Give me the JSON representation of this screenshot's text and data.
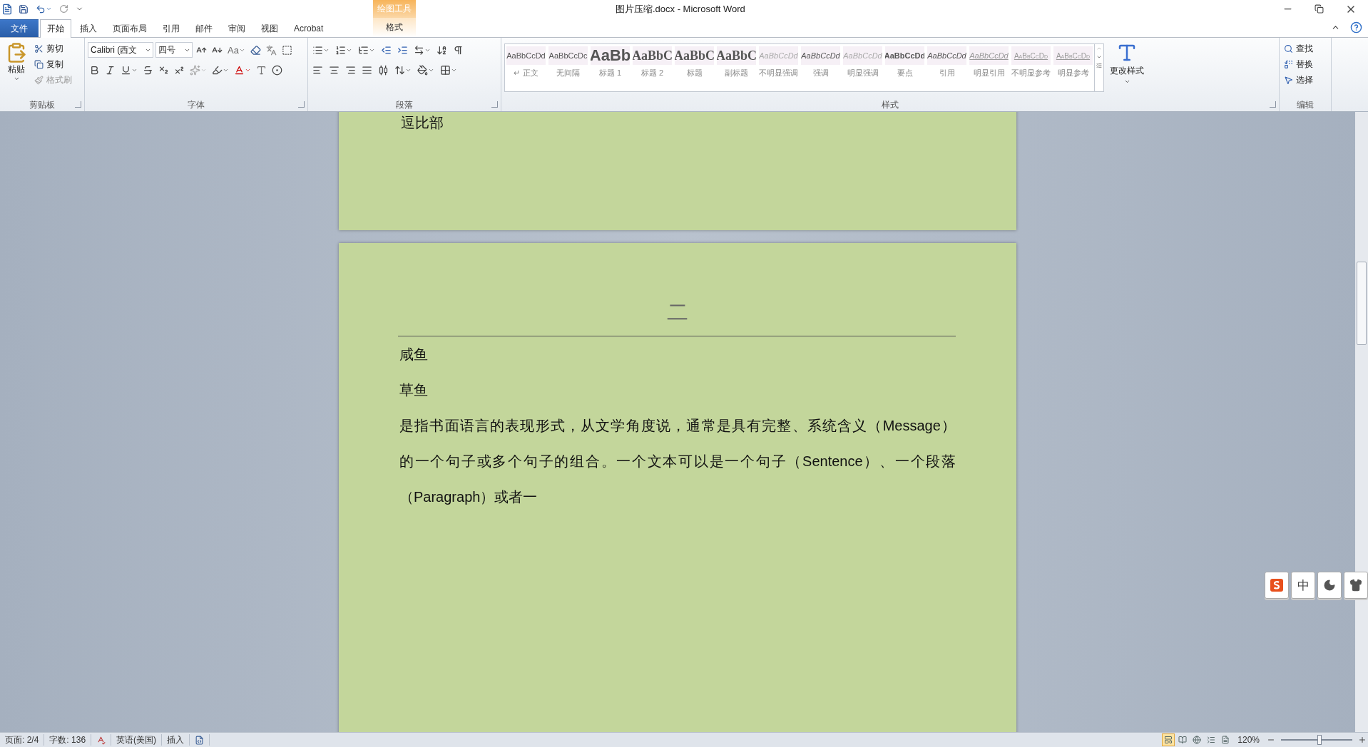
{
  "window": {
    "title": "图片压缩.docx  -  Microsoft Word"
  },
  "tabs": [
    {
      "label": "文件",
      "kind": "file",
      "selected": false
    },
    {
      "label": "开始",
      "kind": "normal",
      "selected": true
    },
    {
      "label": "插入",
      "kind": "normal",
      "selected": false
    },
    {
      "label": "页面布局",
      "kind": "normal",
      "selected": false
    },
    {
      "label": "引用",
      "kind": "normal",
      "selected": false
    },
    {
      "label": "邮件",
      "kind": "normal",
      "selected": false
    },
    {
      "label": "审阅",
      "kind": "normal",
      "selected": false
    },
    {
      "label": "视图",
      "kind": "normal",
      "selected": false
    },
    {
      "label": "Acrobat",
      "kind": "normal",
      "selected": false
    }
  ],
  "contextual_tabs": {
    "group": "绘图工具",
    "tabs": [
      {
        "label": "格式",
        "selected": false
      }
    ]
  },
  "ribbon": {
    "clipboard": {
      "paste": "粘贴",
      "group_label": "剪贴板",
      "buttons": [
        {
          "label": "剪切",
          "kind": "cut",
          "disabled": false
        },
        {
          "label": "复制",
          "kind": "copy",
          "disabled": false
        },
        {
          "label": "格式刷",
          "kind": "brush",
          "disabled": true
        }
      ]
    },
    "font": {
      "font_name": "Calibri (西文",
      "font_size": "四号",
      "change_case": "Aa",
      "group_label": "字体"
    },
    "paragraph": {
      "group_label": "段落"
    },
    "styles": {
      "group_label": "样式",
      "change_styles": "更改样式",
      "items": [
        {
          "preview": "AaBbCcDd",
          "label": "↵ 正文",
          "kind": "plain"
        },
        {
          "preview": "AaBbCcDc",
          "label": "无间隔",
          "kind": "plain"
        },
        {
          "preview": "AaBb",
          "label": "标题 1",
          "kind": "heading1"
        },
        {
          "preview": "AaBbC",
          "label": "标题 2",
          "kind": "heading2"
        },
        {
          "preview": "AaBbC",
          "label": "标题",
          "kind": "heading2"
        },
        {
          "preview": "AaBbC",
          "label": "副标题",
          "kind": "heading2"
        },
        {
          "preview": "AaBbCcDd",
          "label": "不明显强调",
          "kind": "faded"
        },
        {
          "preview": "AaBbCcDd",
          "label": "强调",
          "kind": "italic"
        },
        {
          "preview": "AaBbCcDd",
          "label": "明显强调",
          "kind": "faded"
        },
        {
          "preview": "AaBbCcDd",
          "label": "要点",
          "kind": "bold"
        },
        {
          "preview": "AaBbCcDd",
          "label": "引用",
          "kind": "italic"
        },
        {
          "preview": "AaBbCcDd",
          "label": "明显引用",
          "kind": "underline"
        },
        {
          "preview": "AaBbCcDd",
          "label": "不明显参考",
          "kind": "smallcaps"
        },
        {
          "preview": "AaBbCcDd",
          "label": "明显参考",
          "kind": "smallcaps"
        }
      ]
    },
    "editing": {
      "group_label": "编辑",
      "buttons": [
        {
          "label": "查找",
          "kind": "find"
        },
        {
          "label": "替换",
          "kind": "replace"
        },
        {
          "label": "选择",
          "kind": "select"
        }
      ]
    }
  },
  "document": {
    "pages": [
      {
        "kind": "tail",
        "lines": [
          "逗比部"
        ]
      },
      {
        "kind": "titled",
        "heading": "二",
        "lines": [
          "咸鱼",
          "草鱼"
        ],
        "body_lines": [
          "是指书面语言的表现形式，从文学角度说，通常是具有完整、系统含义（Message）",
          "的一个句子或多个句子的组合。一个文本可以是一个句子（Sentence）、一个段落",
          "（Paragraph）或者一"
        ]
      }
    ]
  },
  "ime_toolbar": {
    "buttons": [
      {
        "kind": "logo"
      },
      {
        "kind": "text",
        "label": "中"
      },
      {
        "kind": "moon"
      },
      {
        "kind": "shirt"
      }
    ]
  },
  "status_bar": {
    "page": "页面: 2/4",
    "words": "字数: 136",
    "language": "英语(美国)",
    "mode": "插入",
    "zoom": "120%",
    "views": [
      {
        "selected": true
      },
      {
        "selected": false
      },
      {
        "selected": false
      },
      {
        "selected": false
      },
      {
        "selected": false
      }
    ],
    "zoom_slider": {
      "level": 0.55
    }
  }
}
